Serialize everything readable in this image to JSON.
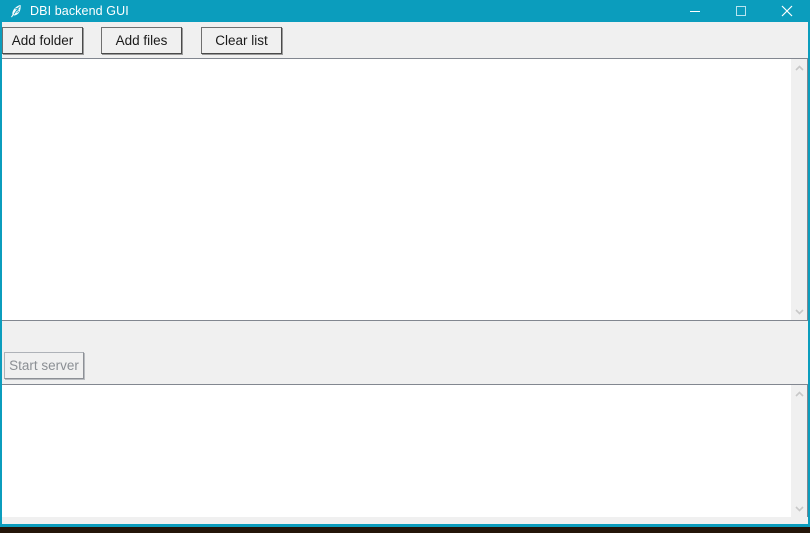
{
  "window": {
    "title": "DBI backend GUI",
    "icon": "feather-icon",
    "accent_color": "#0b9dbd",
    "controls": {
      "minimize": "minimize-icon",
      "maximize": "maximize-icon",
      "close": "close-icon"
    }
  },
  "toolbar": {
    "buttons": [
      {
        "label": "Add folder",
        "name": "add-folder-button",
        "enabled": true
      },
      {
        "label": "Add files",
        "name": "add-files-button",
        "enabled": true
      },
      {
        "label": "Clear list",
        "name": "clear-list-button",
        "enabled": true
      }
    ]
  },
  "file_list": {
    "value": "",
    "placeholder": "",
    "scrollbar": {
      "up_arrow": "chevron-up-icon",
      "down_arrow": "chevron-down-icon"
    }
  },
  "server_panel": {
    "start_button": {
      "label": "Start server",
      "name": "start-server-button",
      "enabled": false
    }
  },
  "log_output": {
    "value": "",
    "placeholder": "",
    "scrollbar": {
      "up_arrow": "chevron-up-icon",
      "down_arrow": "chevron-down-icon"
    }
  }
}
